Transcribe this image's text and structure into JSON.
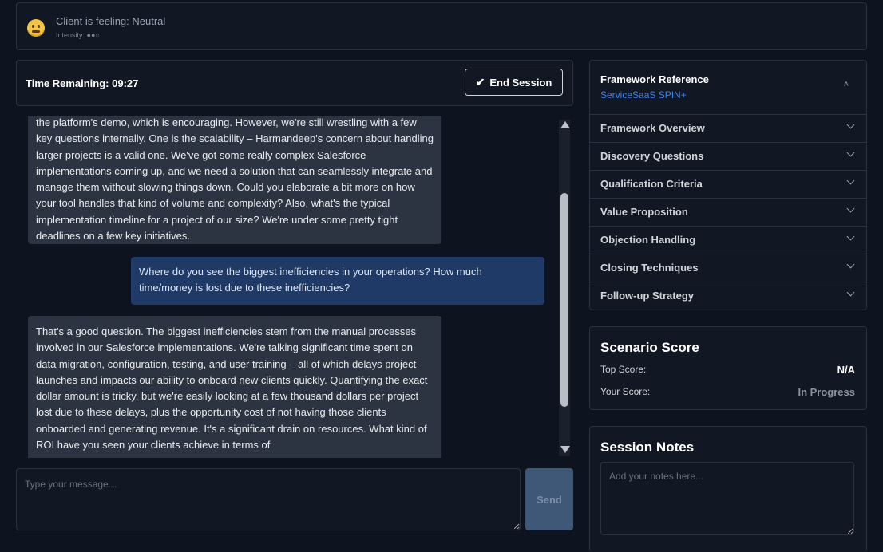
{
  "mood": {
    "label": "Client is feeling: Neutral",
    "intensity": "Intensity: ●●○"
  },
  "session": {
    "time_remaining": "Time Remaining: 09:27",
    "end_button": "End Session"
  },
  "chat": {
    "messages": [
      {
        "role": "client",
        "text": "the platform's demo, which is encouraging. However, we're still wrestling with a few key questions internally. One is the scalability – Harmandeep's concern about handling larger projects is a valid one. We've got some really complex Salesforce implementations coming up, and we need a solution that can seamlessly integrate and manage them without slowing things down. Could you elaborate a bit more on how your tool handles that kind of volume and complexity? Also, what's the typical implementation timeline for a project of our size? We're under some pretty tight deadlines on a few key initiatives."
      },
      {
        "role": "user",
        "text": "Where do you see the biggest inefficiencies in your operations? How much time/money is lost due to these inefficiencies?"
      },
      {
        "role": "client",
        "text": "That's a good question. The biggest inefficiencies stem from the manual processes involved in our Salesforce implementations. We're talking significant time spent on data migration, configuration, testing, and user training – all of which delays project launches and impacts our ability to onboard new clients quickly. Quantifying the exact dollar amount is tricky, but we're easily looking at a few thousand dollars per project lost due to these delays, plus the opportunity cost of not having those clients onboarded and generating revenue. It's a significant drain on resources. What kind of ROI have you seen your clients achieve in terms of"
      }
    ],
    "input_placeholder": "Type your message...",
    "send_label": "Send"
  },
  "framework": {
    "title": "Framework Reference",
    "subtitle": "ServiceSaaS SPIN+",
    "items": [
      {
        "label": "Framework Overview"
      },
      {
        "label": "Discovery Questions"
      },
      {
        "label": "Qualification Criteria"
      },
      {
        "label": "Value Proposition"
      },
      {
        "label": "Objection Handling"
      },
      {
        "label": "Closing Techniques"
      },
      {
        "label": "Follow-up Strategy"
      }
    ]
  },
  "score": {
    "title": "Scenario Score",
    "top_label": "Top Score:",
    "top_value": "N/A",
    "your_label": "Your Score:",
    "your_value": "In Progress"
  },
  "notes": {
    "title": "Session Notes",
    "placeholder": "Add your notes here..."
  },
  "colors": {
    "background": "#0e1320",
    "panel": "#111723",
    "client_bubble": "#2d3441",
    "user_bubble": "#1f3a66",
    "accent": "#3b82f6"
  }
}
